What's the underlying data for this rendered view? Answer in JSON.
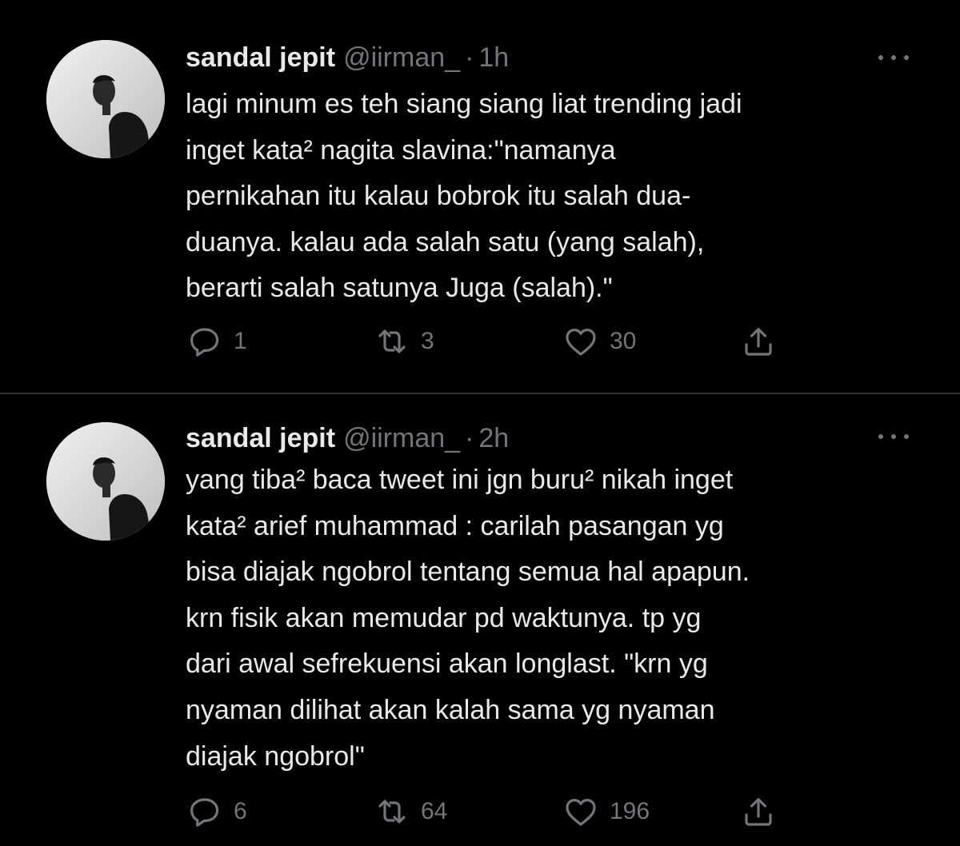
{
  "tweets": [
    {
      "display_name": "sandal jepit",
      "handle": "@iirman_",
      "separator": "·",
      "time": "1h",
      "text": "lagi minum es teh siang siang liat trending jadi\ninget kata² nagita slavina:\"namanya\npernikahan itu kalau bobrok itu salah dua-\nduanya. kalau ada salah satu (yang salah),\nberarti salah satunya Juga (salah).\"",
      "replies": "1",
      "retweets": "3",
      "likes": "30"
    },
    {
      "display_name": "sandal jepit",
      "handle": "@iirman_",
      "separator": "·",
      "time": "2h",
      "text": "yang tiba² baca tweet ini jgn buru² nikah inget\nkata² arief muhammad : carilah pasangan yg\nbisa diajak ngobrol tentang semua hal apapun.\nkrn fisik akan memudar pd waktunya. tp yg\ndari awal sefrekuensi akan longlast. \"krn yg\nnyaman dilihat akan kalah sama yg nyaman\ndiajak ngobrol\"",
      "replies": "6",
      "retweets": "64",
      "likes": "196"
    }
  ],
  "icons": {
    "reply": "reply-icon",
    "retweet": "retweet-icon",
    "like": "heart-icon",
    "share": "share-icon",
    "more": "more-icon"
  },
  "colors": {
    "background": "#000000",
    "text": "#e7e9ea",
    "secondary": "#71767b",
    "divider": "#2f3336"
  }
}
